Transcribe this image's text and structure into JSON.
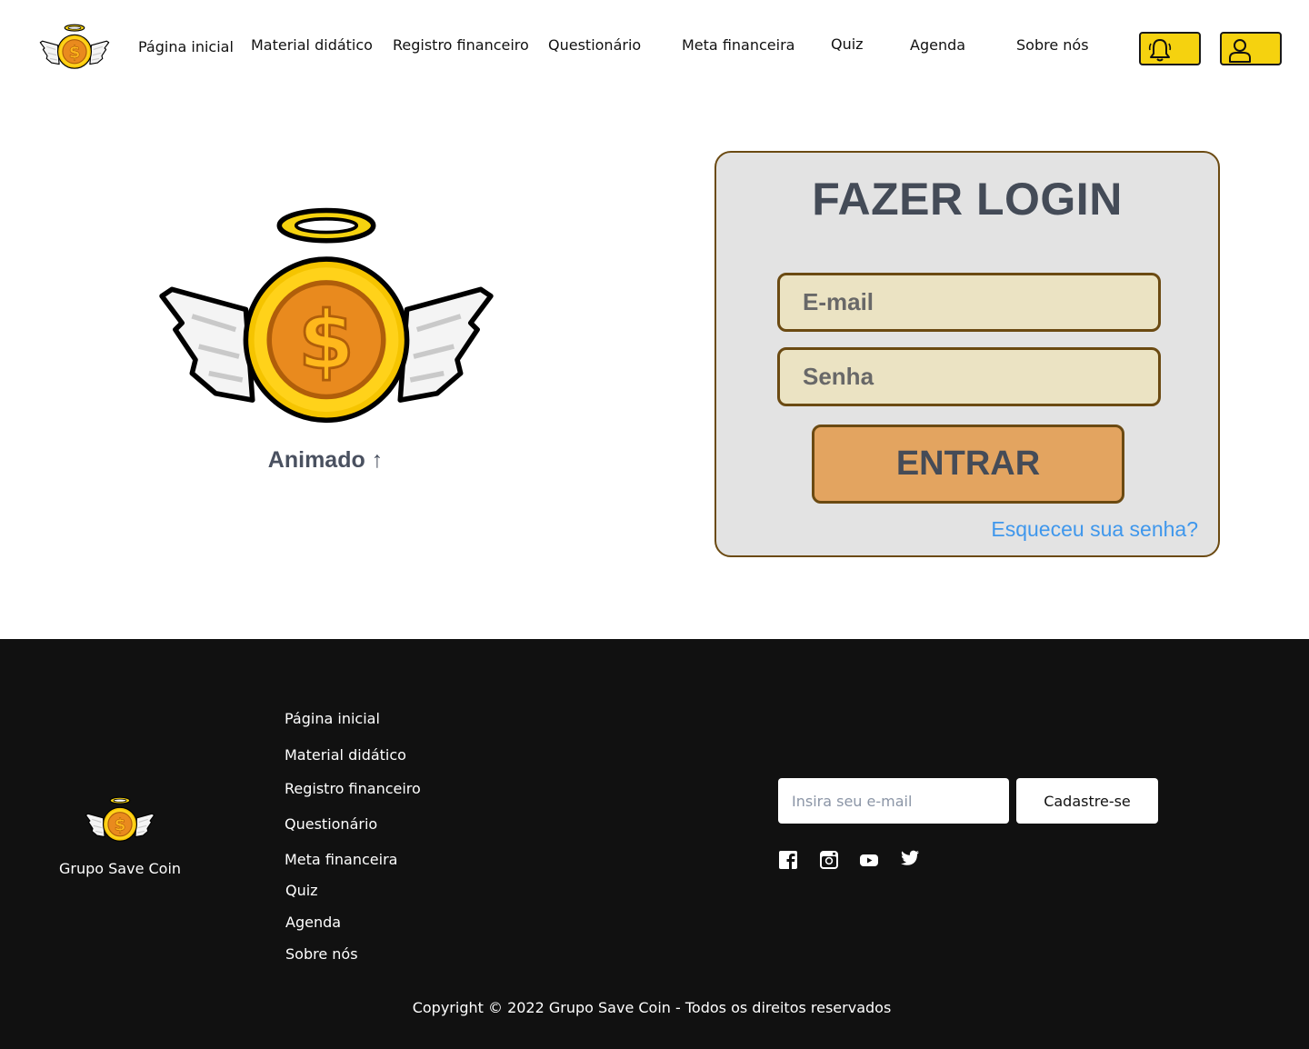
{
  "header": {
    "logo_icon": "angel-coin-logo",
    "nav": [
      "Página inicial",
      "Material didático",
      "Registro financeiro",
      "Questionário",
      "Meta financeira",
      "Quiz",
      "Agenda",
      "Sobre nós"
    ],
    "notification_icon": "bell-icon",
    "profile_icon": "user-icon",
    "accent_color": "#f5d20f"
  },
  "hero": {
    "logo_icon": "angel-coin-logo",
    "caption": "Animado ↑"
  },
  "login": {
    "title": "FAZER LOGIN",
    "email_placeholder": "E-mail",
    "password_placeholder": "Senha",
    "submit_label": "ENTRAR",
    "forgot_label": "Esqueceu sua senha?",
    "card_color": "#e3e3e3",
    "field_color": "#ebe3c3",
    "button_color": "#e3a460",
    "link_color": "#3f97ec"
  },
  "footer": {
    "brand": "Grupo Save Coin",
    "links": [
      "Página inicial",
      "Material didático",
      "Registro financeiro",
      "Questionário",
      "Meta financeira",
      "Quiz",
      "Agenda",
      "Sobre nós"
    ],
    "newsletter_placeholder": "Insira seu e-mail",
    "newsletter_button": "Cadastre-se",
    "social_icons": [
      "facebook-icon",
      "instagram-icon",
      "youtube-icon",
      "twitter-icon"
    ],
    "copyright": "Copyright © 2022 Grupo Save Coin - Todos os direitos reservados",
    "background_color": "#111111"
  }
}
